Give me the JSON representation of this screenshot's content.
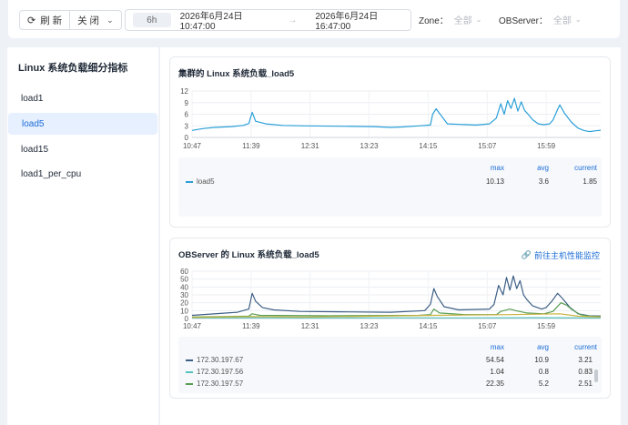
{
  "toolbar": {
    "refresh_label": "刷 新",
    "auto_refresh_label": "关 闭",
    "time_span": "6h",
    "start_time": "2026年6月24日 10:47:00",
    "end_time": "2026年6月24日 16:47:00",
    "arrow": "→",
    "zone_label": "Zone：",
    "zone_value": "全部",
    "observer_label": "OBServer：",
    "observer_value": "全部"
  },
  "sidebar": {
    "title": "Linux 系统负载细分指标",
    "items": [
      {
        "label": "load1",
        "active": false
      },
      {
        "label": "load5",
        "active": true
      },
      {
        "label": "load15",
        "active": false
      },
      {
        "label": "load1_per_cpu",
        "active": false
      }
    ]
  },
  "colors": {
    "accent": "#1a6bd6",
    "series_cluster": "#2a9fd8",
    "series_1": "#3d5f86",
    "series_2": "#56c2be",
    "series_3": "#5a9e53",
    "series_4": "#c7b03a"
  },
  "legend_headers": {
    "max": "max",
    "avg": "avg",
    "current": "current"
  },
  "cards": [
    {
      "title": "集群的 Linux 系统负载_load5",
      "link": "",
      "legend": [
        {
          "name": "load5",
          "max": "10.13",
          "avg": "3.6",
          "current": "1.85",
          "color": "#2a9fd8"
        }
      ]
    },
    {
      "title": "OBServer 的 Linux 系统负载_load5",
      "link": "前往主机性能监控",
      "legend": [
        {
          "name": "172.30.197.67",
          "max": "54.54",
          "avg": "10.9",
          "current": "3.21",
          "color": "#3d5f86"
        },
        {
          "name": "172.30.197.56",
          "max": "1.04",
          "avg": "0.8",
          "current": "0.83",
          "color": "#56c2be"
        },
        {
          "name": "172.30.197.57",
          "max": "22.35",
          "avg": "5.2",
          "current": "2.51",
          "color": "#5a9e53"
        }
      ]
    }
  ],
  "chart_data": [
    {
      "type": "line",
      "title": "集群的 Linux 系统负载_load5",
      "x_ticks": [
        "10:47",
        "11:39",
        "12:31",
        "13:23",
        "14:15",
        "15:07",
        "15:59"
      ],
      "x_range_minutes": [
        0,
        360
      ],
      "ylim": [
        0,
        12
      ],
      "y_ticks": [
        0,
        3,
        6,
        9,
        12
      ],
      "grid": true,
      "series": [
        {
          "name": "load5",
          "color": "#2a9fd8",
          "points": [
            [
              0,
              1.8
            ],
            [
              10,
              2.3
            ],
            [
              20,
              2.6
            ],
            [
              35,
              2.8
            ],
            [
              45,
              3.1
            ],
            [
              50,
              3.6
            ],
            [
              53,
              6.5
            ],
            [
              56,
              4.2
            ],
            [
              65,
              3.5
            ],
            [
              80,
              3.1
            ],
            [
              100,
              3.0
            ],
            [
              130,
              2.9
            ],
            [
              160,
              2.8
            ],
            [
              175,
              2.6
            ],
            [
              185,
              2.7
            ],
            [
              200,
              3.0
            ],
            [
              210,
              3.2
            ],
            [
              212,
              6.0
            ],
            [
              215,
              7.4
            ],
            [
              218,
              6.2
            ],
            [
              225,
              3.5
            ],
            [
              250,
              3.2
            ],
            [
              262,
              3.5
            ],
            [
              268,
              5.0
            ],
            [
              272,
              8.7
            ],
            [
              275,
              6.0
            ],
            [
              278,
              9.5
            ],
            [
              281,
              7.5
            ],
            [
              284,
              10.1
            ],
            [
              287,
              6.8
            ],
            [
              290,
              9.2
            ],
            [
              293,
              7.0
            ],
            [
              296,
              6.0
            ],
            [
              300,
              4.6
            ],
            [
              305,
              3.5
            ],
            [
              310,
              3.3
            ],
            [
              315,
              3.5
            ],
            [
              318,
              4.5
            ],
            [
              322,
              7.2
            ],
            [
              324,
              8.4
            ],
            [
              328,
              6.3
            ],
            [
              334,
              4.0
            ],
            [
              340,
              2.4
            ],
            [
              345,
              1.8
            ],
            [
              350,
              1.5
            ],
            [
              355,
              1.7
            ],
            [
              360,
              1.85
            ]
          ]
        }
      ]
    },
    {
      "type": "line",
      "title": "OBServer 的 Linux 系统负载_load5",
      "x_ticks": [
        "10:47",
        "11:39",
        "12:31",
        "13:23",
        "14:15",
        "15:07",
        "15:59"
      ],
      "x_range_minutes": [
        0,
        360
      ],
      "ylim": [
        0,
        60
      ],
      "y_ticks": [
        0,
        10,
        20,
        30,
        40,
        50,
        60
      ],
      "grid": true,
      "series": [
        {
          "name": "172.30.197.67",
          "color": "#3d5f86",
          "points": [
            [
              0,
              4
            ],
            [
              40,
              8
            ],
            [
              50,
              12
            ],
            [
              53,
              32
            ],
            [
              56,
              22
            ],
            [
              62,
              14
            ],
            [
              72,
              11
            ],
            [
              95,
              9
            ],
            [
              130,
              8.5
            ],
            [
              175,
              8
            ],
            [
              205,
              10
            ],
            [
              210,
              18
            ],
            [
              213,
              38
            ],
            [
              216,
              28
            ],
            [
              222,
              15
            ],
            [
              235,
              11
            ],
            [
              262,
              12
            ],
            [
              266,
              18
            ],
            [
              270,
              42
            ],
            [
              274,
              30
            ],
            [
              277,
              52
            ],
            [
              280,
              36
            ],
            [
              283,
              54
            ],
            [
              286,
              38
            ],
            [
              289,
              48
            ],
            [
              292,
              30
            ],
            [
              295,
              24
            ],
            [
              300,
              16
            ],
            [
              308,
              12
            ],
            [
              312,
              14
            ],
            [
              317,
              22
            ],
            [
              322,
              32
            ],
            [
              326,
              26
            ],
            [
              333,
              14
            ],
            [
              340,
              6
            ],
            [
              350,
              3.5
            ],
            [
              360,
              3.2
            ]
          ]
        },
        {
          "name": "172.30.197.56",
          "color": "#56c2be",
          "points": [
            [
              0,
              0.8
            ],
            [
              60,
              0.9
            ],
            [
              120,
              0.8
            ],
            [
              180,
              0.9
            ],
            [
              240,
              0.8
            ],
            [
              300,
              1.0
            ],
            [
              360,
              0.83
            ]
          ]
        },
        {
          "name": "172.30.197.57",
          "color": "#5a9e53",
          "points": [
            [
              0,
              2
            ],
            [
              50,
              3
            ],
            [
              53,
              6
            ],
            [
              60,
              4
            ],
            [
              120,
              3.5
            ],
            [
              200,
              4
            ],
            [
              210,
              5
            ],
            [
              213,
              12
            ],
            [
              218,
              7
            ],
            [
              240,
              5
            ],
            [
              268,
              5
            ],
            [
              272,
              9
            ],
            [
              280,
              12
            ],
            [
              285,
              10
            ],
            [
              295,
              7
            ],
            [
              310,
              6
            ],
            [
              318,
              9
            ],
            [
              325,
              20
            ],
            [
              330,
              17
            ],
            [
              335,
              11
            ],
            [
              342,
              5
            ],
            [
              350,
              3
            ],
            [
              360,
              2.5
            ]
          ]
        },
        {
          "name": "",
          "color": "#c7b03a",
          "points": [
            [
              0,
              1.5
            ],
            [
              53,
              2.5
            ],
            [
              100,
              2
            ],
            [
              213,
              4
            ],
            [
              280,
              5
            ],
            [
              324,
              6
            ],
            [
              340,
              3
            ],
            [
              360,
              2
            ]
          ]
        }
      ]
    }
  ]
}
